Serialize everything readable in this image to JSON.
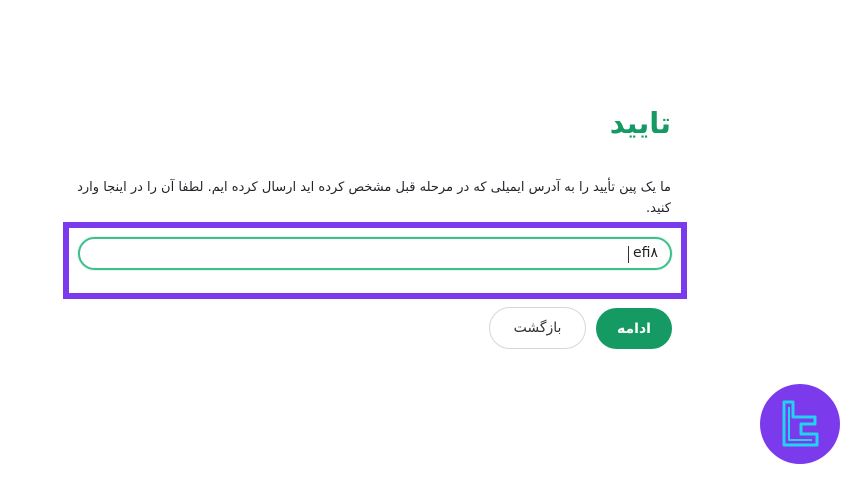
{
  "verify": {
    "title": "تایید",
    "description": "ما یک پین تأیید را به آدرس ایمیلی که در مرحله قبل مشخص کرده اید ارسال کرده ایم. لطفا آن را در اینجا وارد کنید.",
    "pin_value": "efi۸"
  },
  "buttons": {
    "continue_label": "ادامه",
    "back_label": "بازگشت"
  },
  "colors": {
    "accent_green": "#159a64",
    "input_border": "#3fbf8c",
    "highlight_purple": "#7c3aed",
    "logo_cyan": "#22d3ee"
  },
  "icons": {
    "brand_logo": "tradingfinder-logo-icon"
  }
}
